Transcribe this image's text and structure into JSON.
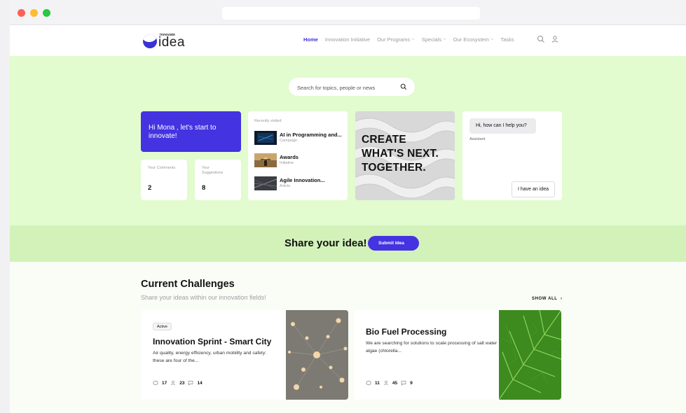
{
  "brand": {
    "small": "innovate",
    "word": "idea",
    "accent": "#4433e0"
  },
  "nav": {
    "items": [
      {
        "label": "Home",
        "dropdown": false,
        "active": true
      },
      {
        "label": "Innovation Initiative",
        "dropdown": false
      },
      {
        "label": "Our Programs",
        "dropdown": true
      },
      {
        "label": "Specials",
        "dropdown": true
      },
      {
        "label": "Our Ecosystem",
        "dropdown": true
      },
      {
        "label": "Tasks",
        "dropdown": false
      }
    ],
    "icons": [
      "search-icon",
      "user-icon"
    ]
  },
  "hero": {
    "search_placeholder": "Search for topics, people or news",
    "greeting": "Hi Mona , let's start to innovate!",
    "comments": {
      "label": "Your Comments",
      "value": "2"
    },
    "suggestions": {
      "label": "Your Suggestions",
      "value": "8"
    },
    "recent": {
      "title": "Recently visited",
      "items": [
        {
          "name": "AI in Programming and...",
          "type": "Campaign"
        },
        {
          "name": "Awards",
          "type": "Initiative"
        },
        {
          "name": "Agile Innovation...",
          "type": "Article"
        }
      ]
    },
    "promo": [
      "CREATE",
      "WHAT'S NEXT.",
      "TOGETHER."
    ],
    "assistant": {
      "message": "Hi, how can I help you?",
      "label": "Assistant",
      "button": "I have an idea"
    }
  },
  "share": {
    "label": "Share your idea!",
    "button": "Submit Idea"
  },
  "challenges": {
    "title": "Current Challenges",
    "subtitle": "Share your ideas within our innovation fields!",
    "show_all": "SHOW ALL",
    "cards": [
      {
        "badge": "Active",
        "title": "Innovation Sprint - Smart City",
        "description": "Air quality, energy efficiency, urban mobility and safety: these are four of the...",
        "ideas": "17",
        "participants": "23",
        "comments": "14"
      },
      {
        "title": "Bio Fuel Processing",
        "description": "We are searching for solutions to scale processing of salt water algae (chlorella...",
        "ideas": "11",
        "participants": "45",
        "comments": "9"
      }
    ]
  }
}
